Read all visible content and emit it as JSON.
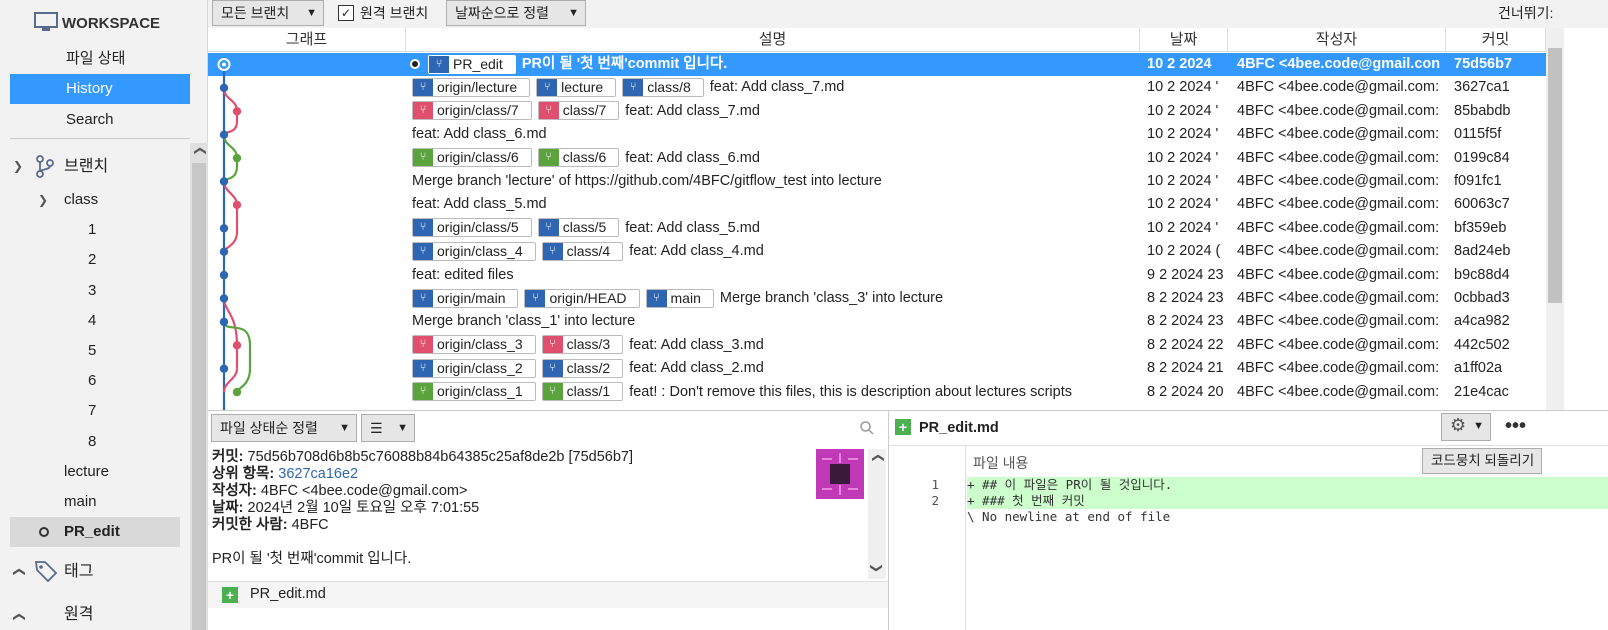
{
  "sidebar": {
    "workspace_label": "WORKSPACE",
    "nav": [
      {
        "label": "파일 상태"
      },
      {
        "label": "History"
      },
      {
        "label": "Search"
      }
    ],
    "branches_label": "브랜치",
    "class_folder": "class",
    "class_items": [
      "1",
      "2",
      "3",
      "4",
      "5",
      "6",
      "7",
      "8"
    ],
    "other_branches": [
      "lecture",
      "main",
      "PR_edit"
    ],
    "tags_label": "태그",
    "remote_label": "원격"
  },
  "toolbar": {
    "branch_select": "모든 브랜치",
    "remote_branch_label": "원격 브랜치",
    "sort_select": "날짜순으로 정렬",
    "skip_label": "건너뛰기:"
  },
  "columns": {
    "graph": "그래프",
    "description": "설명",
    "date": "날짜",
    "author": "작성자",
    "commit": "커밋"
  },
  "commits": [
    {
      "tags": [
        {
          "label": "PR_edit",
          "color": "blue"
        }
      ],
      "message": "PR이 될 '첫 번째'commit 입니다.",
      "date": "10 2 2024",
      "author": "4BFC <4bee.code@gmail.con",
      "hash": "75d56b7"
    },
    {
      "tags": [
        {
          "label": "origin/lecture",
          "color": "blue"
        },
        {
          "label": "lecture",
          "color": "blue"
        },
        {
          "label": "class/8",
          "color": "blue"
        }
      ],
      "message": "feat: Add class_7.md",
      "date": "10 2 2024 '",
      "author": "4BFC <4bee.code@gmail.com:",
      "hash": "3627ca1"
    },
    {
      "tags": [
        {
          "label": "origin/class/7",
          "color": "red"
        },
        {
          "label": "class/7",
          "color": "red"
        }
      ],
      "message": "feat: Add class_7.md",
      "date": "10 2 2024 '",
      "author": "4BFC <4bee.code@gmail.com:",
      "hash": "85babdb"
    },
    {
      "tags": [],
      "message": "feat: Add class_6.md",
      "date": "10 2 2024 '",
      "author": "4BFC <4bee.code@gmail.com:",
      "hash": "0115f5f"
    },
    {
      "tags": [
        {
          "label": "origin/class/6",
          "color": "green"
        },
        {
          "label": "class/6",
          "color": "green"
        }
      ],
      "message": "feat: Add class_6.md",
      "date": "10 2 2024 '",
      "author": "4BFC <4bee.code@gmail.com:",
      "hash": "0199c84"
    },
    {
      "tags": [],
      "message": "Merge branch 'lecture' of https://github.com/4BFC/gitflow_test into lecture",
      "date": "10 2 2024 '",
      "author": "4BFC <4bee.code@gmail.com:",
      "hash": "f091fc1"
    },
    {
      "tags": [],
      "message": "feat: Add class_5.md",
      "date": "10 2 2024 '",
      "author": "4BFC <4bee.code@gmail.com:",
      "hash": "60063c7"
    },
    {
      "tags": [
        {
          "label": "origin/class/5",
          "color": "blue"
        },
        {
          "label": "class/5",
          "color": "blue"
        }
      ],
      "message": "feat: Add class_5.md",
      "date": "10 2 2024 '",
      "author": "4BFC <4bee.code@gmail.com:",
      "hash": "bf359eb"
    },
    {
      "tags": [
        {
          "label": "origin/class_4",
          "color": "blue"
        },
        {
          "label": "class/4",
          "color": "blue"
        }
      ],
      "message": "feat: Add class_4.md",
      "date": "10 2 2024 (",
      "author": "4BFC <4bee.code@gmail.com:",
      "hash": "8ad24eb"
    },
    {
      "tags": [],
      "message": "feat: edited files",
      "date": "9 2 2024 23",
      "author": "4BFC <4bee.code@gmail.com:",
      "hash": "b9c88d4"
    },
    {
      "tags": [
        {
          "label": "origin/main",
          "color": "blue"
        },
        {
          "label": "origin/HEAD",
          "color": "blue"
        },
        {
          "label": "main",
          "color": "blue"
        }
      ],
      "message": "Merge branch 'class_3' into lecture",
      "date": "8 2 2024 23",
      "author": "4BFC <4bee.code@gmail.com:",
      "hash": "0cbbad3"
    },
    {
      "tags": [],
      "message": "Merge branch 'class_1' into lecture",
      "date": "8 2 2024 23",
      "author": "4BFC <4bee.code@gmail.com:",
      "hash": "a4ca982"
    },
    {
      "tags": [
        {
          "label": "origin/class_3",
          "color": "red"
        },
        {
          "label": "class/3",
          "color": "red"
        }
      ],
      "message": "feat: Add class_3.md",
      "date": "8 2 2024 22",
      "author": "4BFC <4bee.code@gmail.com:",
      "hash": "442c502"
    },
    {
      "tags": [
        {
          "label": "origin/class_2",
          "color": "blue"
        },
        {
          "label": "class/2",
          "color": "blue"
        }
      ],
      "message": "feat: Add class_2.md",
      "date": "8 2 2024 21",
      "author": "4BFC <4bee.code@gmail.com:",
      "hash": "a1ff02a"
    },
    {
      "tags": [
        {
          "label": "origin/class_1",
          "color": "green"
        },
        {
          "label": "class/1",
          "color": "green"
        }
      ],
      "message": "feat! : Don't remove this files, this is description about lectures scripts",
      "date": "8 2 2024 20",
      "author": "4BFC <4bee.code@gmail.com:",
      "hash": "21e4cac"
    }
  ],
  "file_panel": {
    "sort_select": "파일 상태순 정렬",
    "view_select": "☰",
    "commit_label": "커밋:",
    "commit_value": "75d56b708d6b8b5c76088b84b64385c25af8de2b [75d56b7]",
    "parent_label": "상위 항목:",
    "parent_value": "3627ca16e2",
    "author_label": "작성자:",
    "author_value": "4BFC <4bee.code@gmail.com>",
    "date_label": "날짜:",
    "date_value": "2024년 2월 10일 토요일 오후 7:01:55",
    "committer_label": "커밋한 사람:",
    "committer_value": "4BFC",
    "message": "PR이 될 '첫 번째'commit 입니다.",
    "file": "PR_edit.md"
  },
  "diff_panel": {
    "file": "PR_edit.md",
    "content_label": "파일 내용",
    "revert_button": "코드뭉치 되돌리기",
    "lines": [
      {
        "num": "1",
        "text": "+ ## 이 파일은 PR이 될 것입니다."
      },
      {
        "num": "2",
        "text": "+ ### 첫 번째 커밋"
      },
      {
        "num": "",
        "text": "\\ No newline at end of file"
      }
    ]
  },
  "colors": {
    "accent": "#3399ff",
    "blue": "#2e66b4",
    "red": "#e0506e",
    "green": "#5aa33d"
  }
}
